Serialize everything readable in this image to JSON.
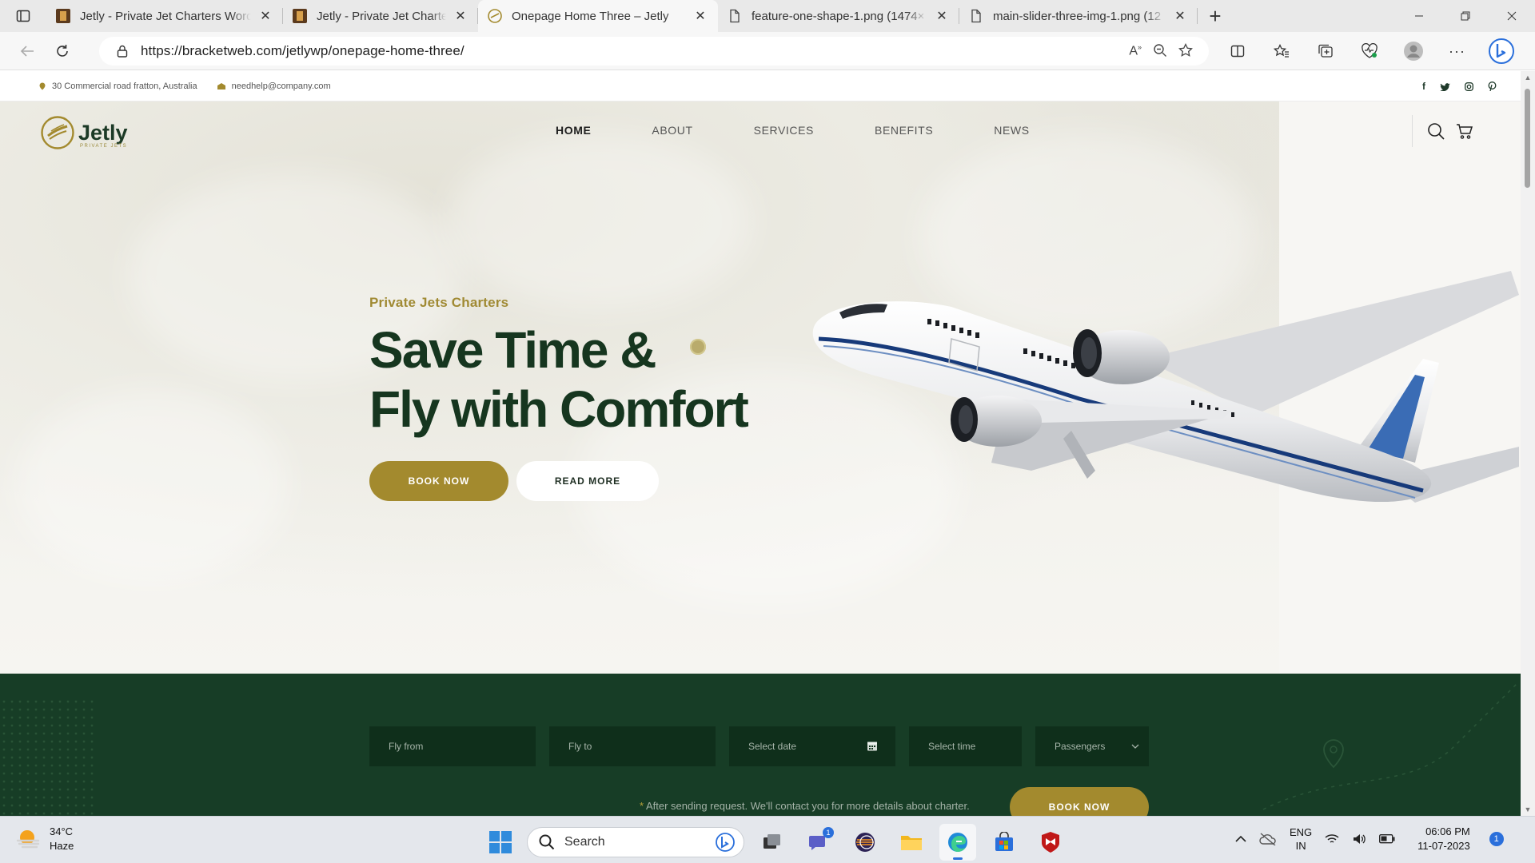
{
  "browser": {
    "tabs": [
      {
        "title": "Jetly - Private Jet Charters WordP",
        "active": false
      },
      {
        "title": "Jetly - Private Jet Charters WordP",
        "active": false
      },
      {
        "title": "Onepage Home Three – Jetly",
        "active": true
      },
      {
        "title": "feature-one-shape-1.png (1474×",
        "active": false
      },
      {
        "title": "main-slider-three-img-1.png (12",
        "active": false
      }
    ],
    "url": "https://bracketweb.com/jetlywp/onepage-home-three/"
  },
  "topbar": {
    "address": "30 Commercial road fratton, Australia",
    "email": "needhelp@company.com",
    "social": [
      "f",
      "t",
      "ig",
      "p"
    ]
  },
  "site": {
    "logo_name": "Jetly",
    "logo_sub": "PRIVATE JETS",
    "menu": [
      "HOME",
      "ABOUT",
      "SERVICES",
      "BENEFITS",
      "NEWS"
    ]
  },
  "hero": {
    "eyebrow": "Private Jets Charters",
    "headline_1": "Save Time &",
    "headline_2": "Fly with Comfort",
    "btn_book": "BOOK NOW",
    "btn_read": "READ MORE"
  },
  "booking": {
    "fly_from": "Fly from",
    "fly_to": "Fly to",
    "date": "Select date",
    "time": "Select time",
    "passengers": "Passengers",
    "note_star": "*",
    "note": " After sending request. We'll contact you for more details about charter.",
    "button": "BOOK NOW"
  },
  "taskbar": {
    "temp": "34°C",
    "weather": "Haze",
    "search": "Search",
    "lang_1": "ENG",
    "lang_2": "IN",
    "time": "06:06 PM",
    "date": "11-07-2023",
    "notifications": "1",
    "teams_badge": "1"
  },
  "colors": {
    "brand_green": "#173d26",
    "brand_gold": "#a38a2e"
  }
}
